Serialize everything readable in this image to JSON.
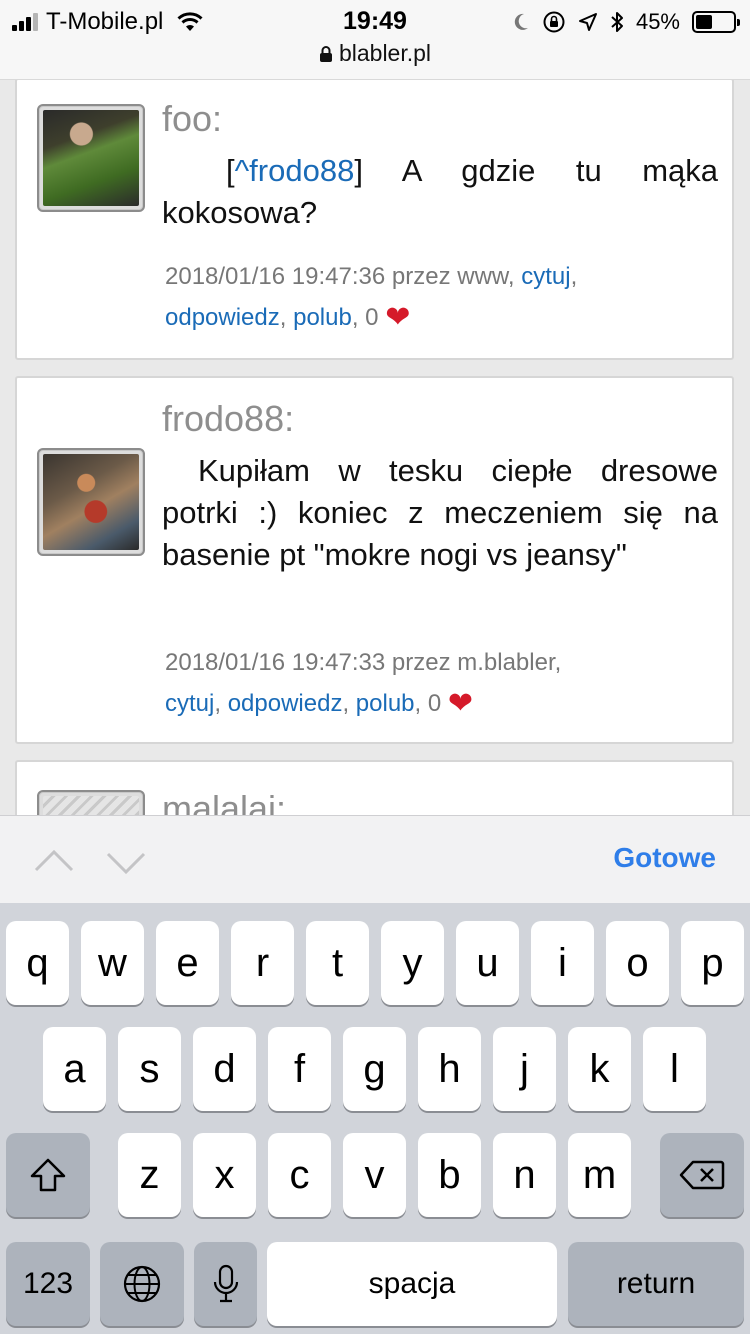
{
  "status_bar": {
    "carrier": "T-Mobile.pl",
    "time": "19:49",
    "url": "blabler.pl",
    "battery_percent": "45%",
    "battery_level": 0.45,
    "icons": [
      "signal-icon",
      "wifi-icon",
      "moon-icon",
      "rotation-lock-icon",
      "location-icon",
      "bluetooth-icon",
      "lock-icon",
      "battery-icon"
    ]
  },
  "posts": [
    {
      "author": "foo:",
      "mention": "^frodo88",
      "text": "A gdzie tu mąka kokosowa?",
      "timestamp": "2018/01/16 19:47:36",
      "via": "przez www,",
      "quote_label": "cytuj",
      "reply_label": "odpowiedz",
      "like_label": "polub",
      "likes": "0"
    },
    {
      "author": "frodo88:",
      "text": "Kupiłam w tesku ciepłe dresowe potrki :) koniec z meczeniem się na basenie pt \"mokre nogi vs jeansy\"",
      "timestamp": "2018/01/16 19:47:33",
      "via": "przez m.blabler,",
      "quote_label": "cytuj",
      "reply_label": "odpowiedz",
      "like_label": "polub",
      "likes": "0"
    },
    {
      "author": "malalai:"
    }
  ],
  "accessory_bar": {
    "done_label": "Gotowe"
  },
  "keyboard": {
    "row1": [
      "q",
      "w",
      "e",
      "r",
      "t",
      "y",
      "u",
      "i",
      "o",
      "p"
    ],
    "row2": [
      "a",
      "s",
      "d",
      "f",
      "g",
      "h",
      "j",
      "k",
      "l"
    ],
    "row3": [
      "z",
      "x",
      "c",
      "v",
      "b",
      "n",
      "m"
    ],
    "numbers_label": "123",
    "space_label": "spacja",
    "return_label": "return"
  },
  "colors": {
    "link": "#1a6bb7",
    "author": "#8e8e8e",
    "heart": "#d51a2a",
    "done": "#2f7ee9",
    "keyboard_bg": "#d1d4da"
  }
}
